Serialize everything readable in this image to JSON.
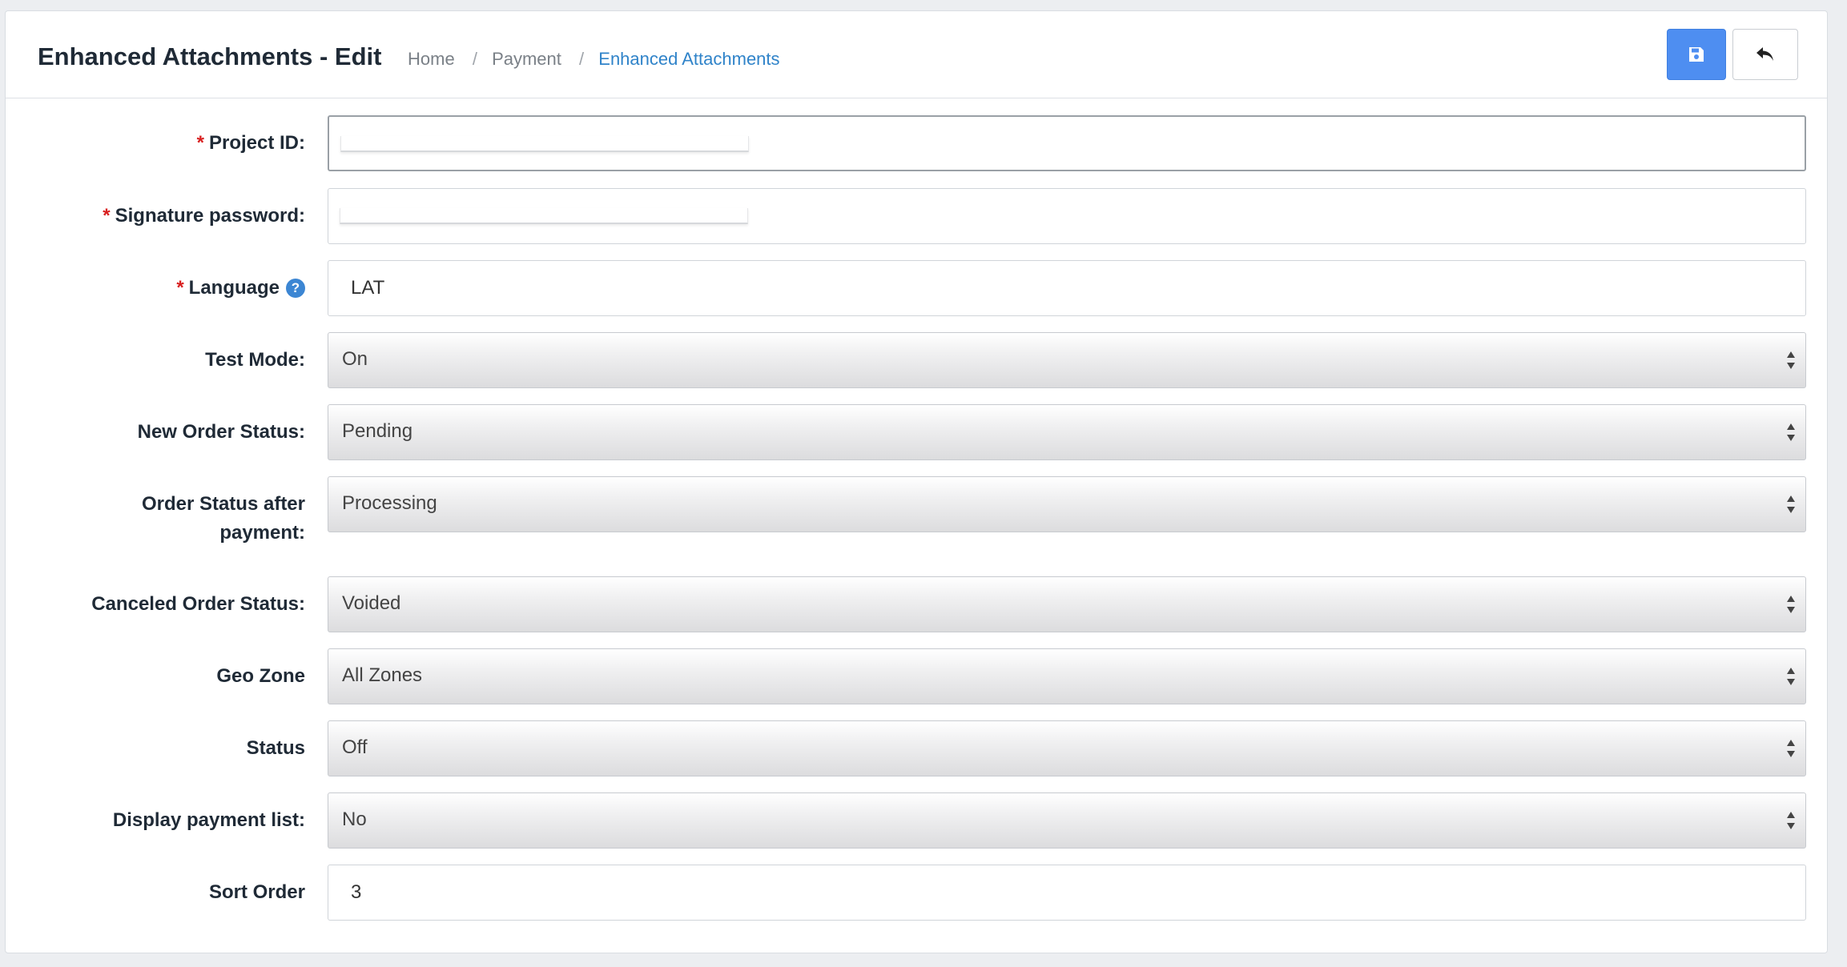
{
  "header": {
    "title": "Enhanced Attachments - Edit",
    "breadcrumb": [
      "Home",
      "Payment",
      "Enhanced Attachments"
    ],
    "save_icon": "floppy-disk-icon",
    "back_icon": "reply-arrow-icon",
    "save_color": "#4e8ef1"
  },
  "form": {
    "project_id": {
      "label": "Project ID:",
      "value": "",
      "required": true
    },
    "signature_password": {
      "label": "Signature password:",
      "value": "",
      "required": true
    },
    "language": {
      "label": "Language",
      "value": "LAT",
      "required": true,
      "help_icon": "question-circle-icon"
    },
    "test_mode": {
      "label": "Test Mode:",
      "value": "On"
    },
    "new_order_status": {
      "label": "New Order Status:",
      "value": "Pending"
    },
    "order_status_after_payment": {
      "label": "Order Status after payment:",
      "value": "Processing"
    },
    "canceled_order_status": {
      "label": "Canceled Order Status:",
      "value": "Voided"
    },
    "geo_zone": {
      "label": "Geo Zone",
      "value": "All Zones"
    },
    "status": {
      "label": "Status",
      "value": "Off"
    },
    "display_payment_list": {
      "label": "Display payment list:",
      "value": "No"
    },
    "sort_order": {
      "label": "Sort Order",
      "value": "3"
    }
  },
  "required_mark": "*",
  "help_glyph": "?"
}
